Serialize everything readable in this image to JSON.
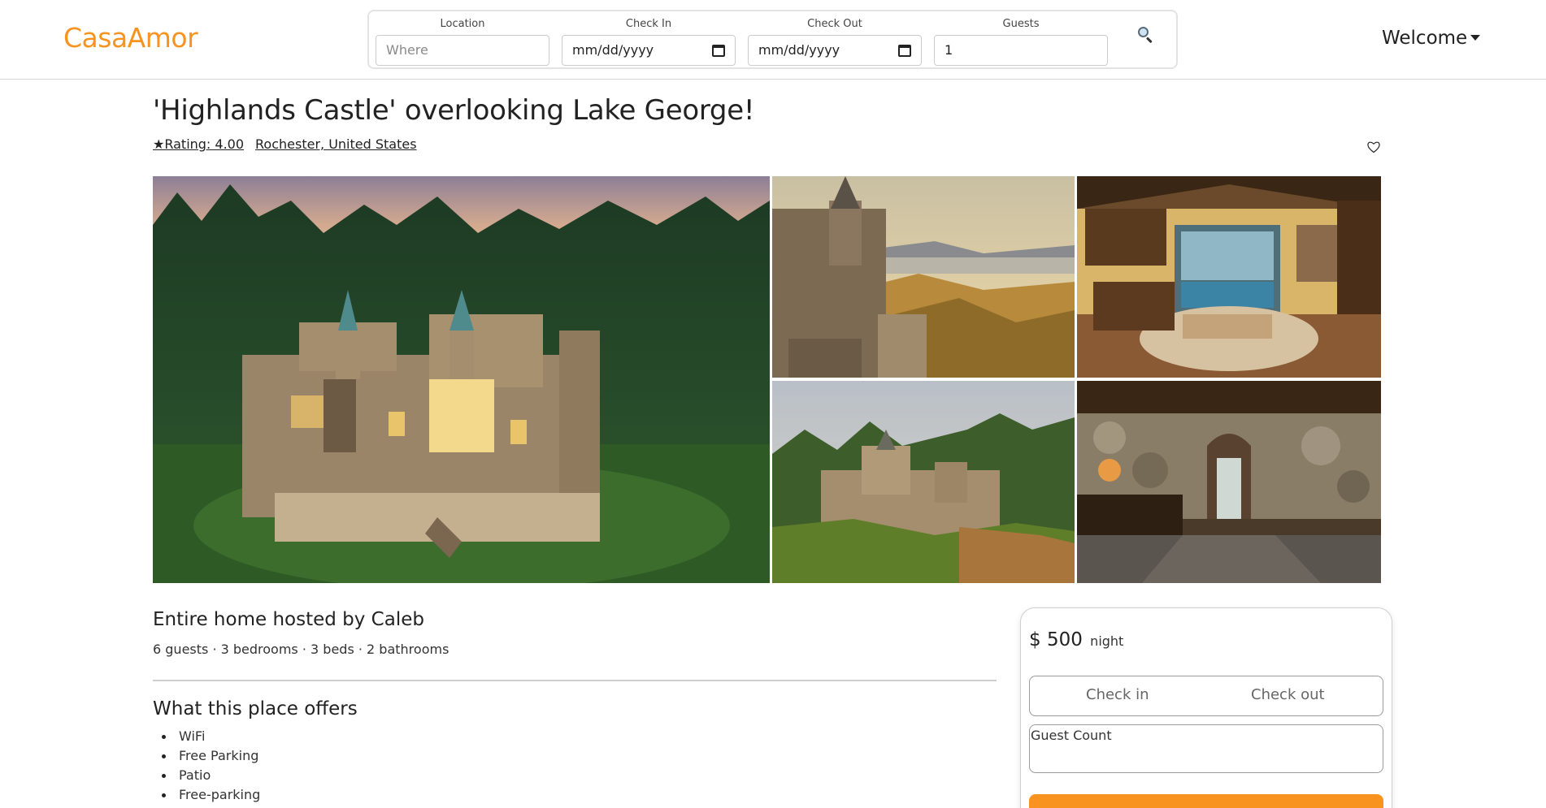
{
  "brand": {
    "name": "CasaAmor",
    "accent_color": "#f7931e"
  },
  "search": {
    "location": {
      "label": "Location",
      "placeholder": "Where"
    },
    "check_in": {
      "label": "Check In",
      "value": "mm/dd/yyyy"
    },
    "check_out": {
      "label": "Check Out",
      "value": "mm/dd/yyyy"
    },
    "guests": {
      "label": "Guests",
      "value": "1"
    },
    "button_icon": "search-icon"
  },
  "user_menu": {
    "label": "Welcome"
  },
  "listing": {
    "title": "'Highlands Castle' overlooking Lake George!",
    "rating": "★Rating: 4.00",
    "location": "Rochester, United States",
    "favorite_icon": "heart-outline-icon",
    "photos": [
      "castle-aerial-dusk",
      "castle-tower-lake-view",
      "great-hall-interior",
      "castle-on-hillside",
      "stone-hallway-interior"
    ]
  },
  "details": {
    "host_line": "Entire home hosted by Caleb",
    "summary": "6 guests · 3 bedrooms · 3 beds · 2 bathrooms",
    "offers_title": "What this place offers",
    "amenities": [
      "WiFi",
      "Free Parking",
      "Patio",
      "Free-parking"
    ]
  },
  "booking": {
    "price": "$ 500",
    "unit": "night",
    "check_in_label": "Check in",
    "check_out_label": "Check out",
    "guest_count_label": "Guest Count"
  }
}
